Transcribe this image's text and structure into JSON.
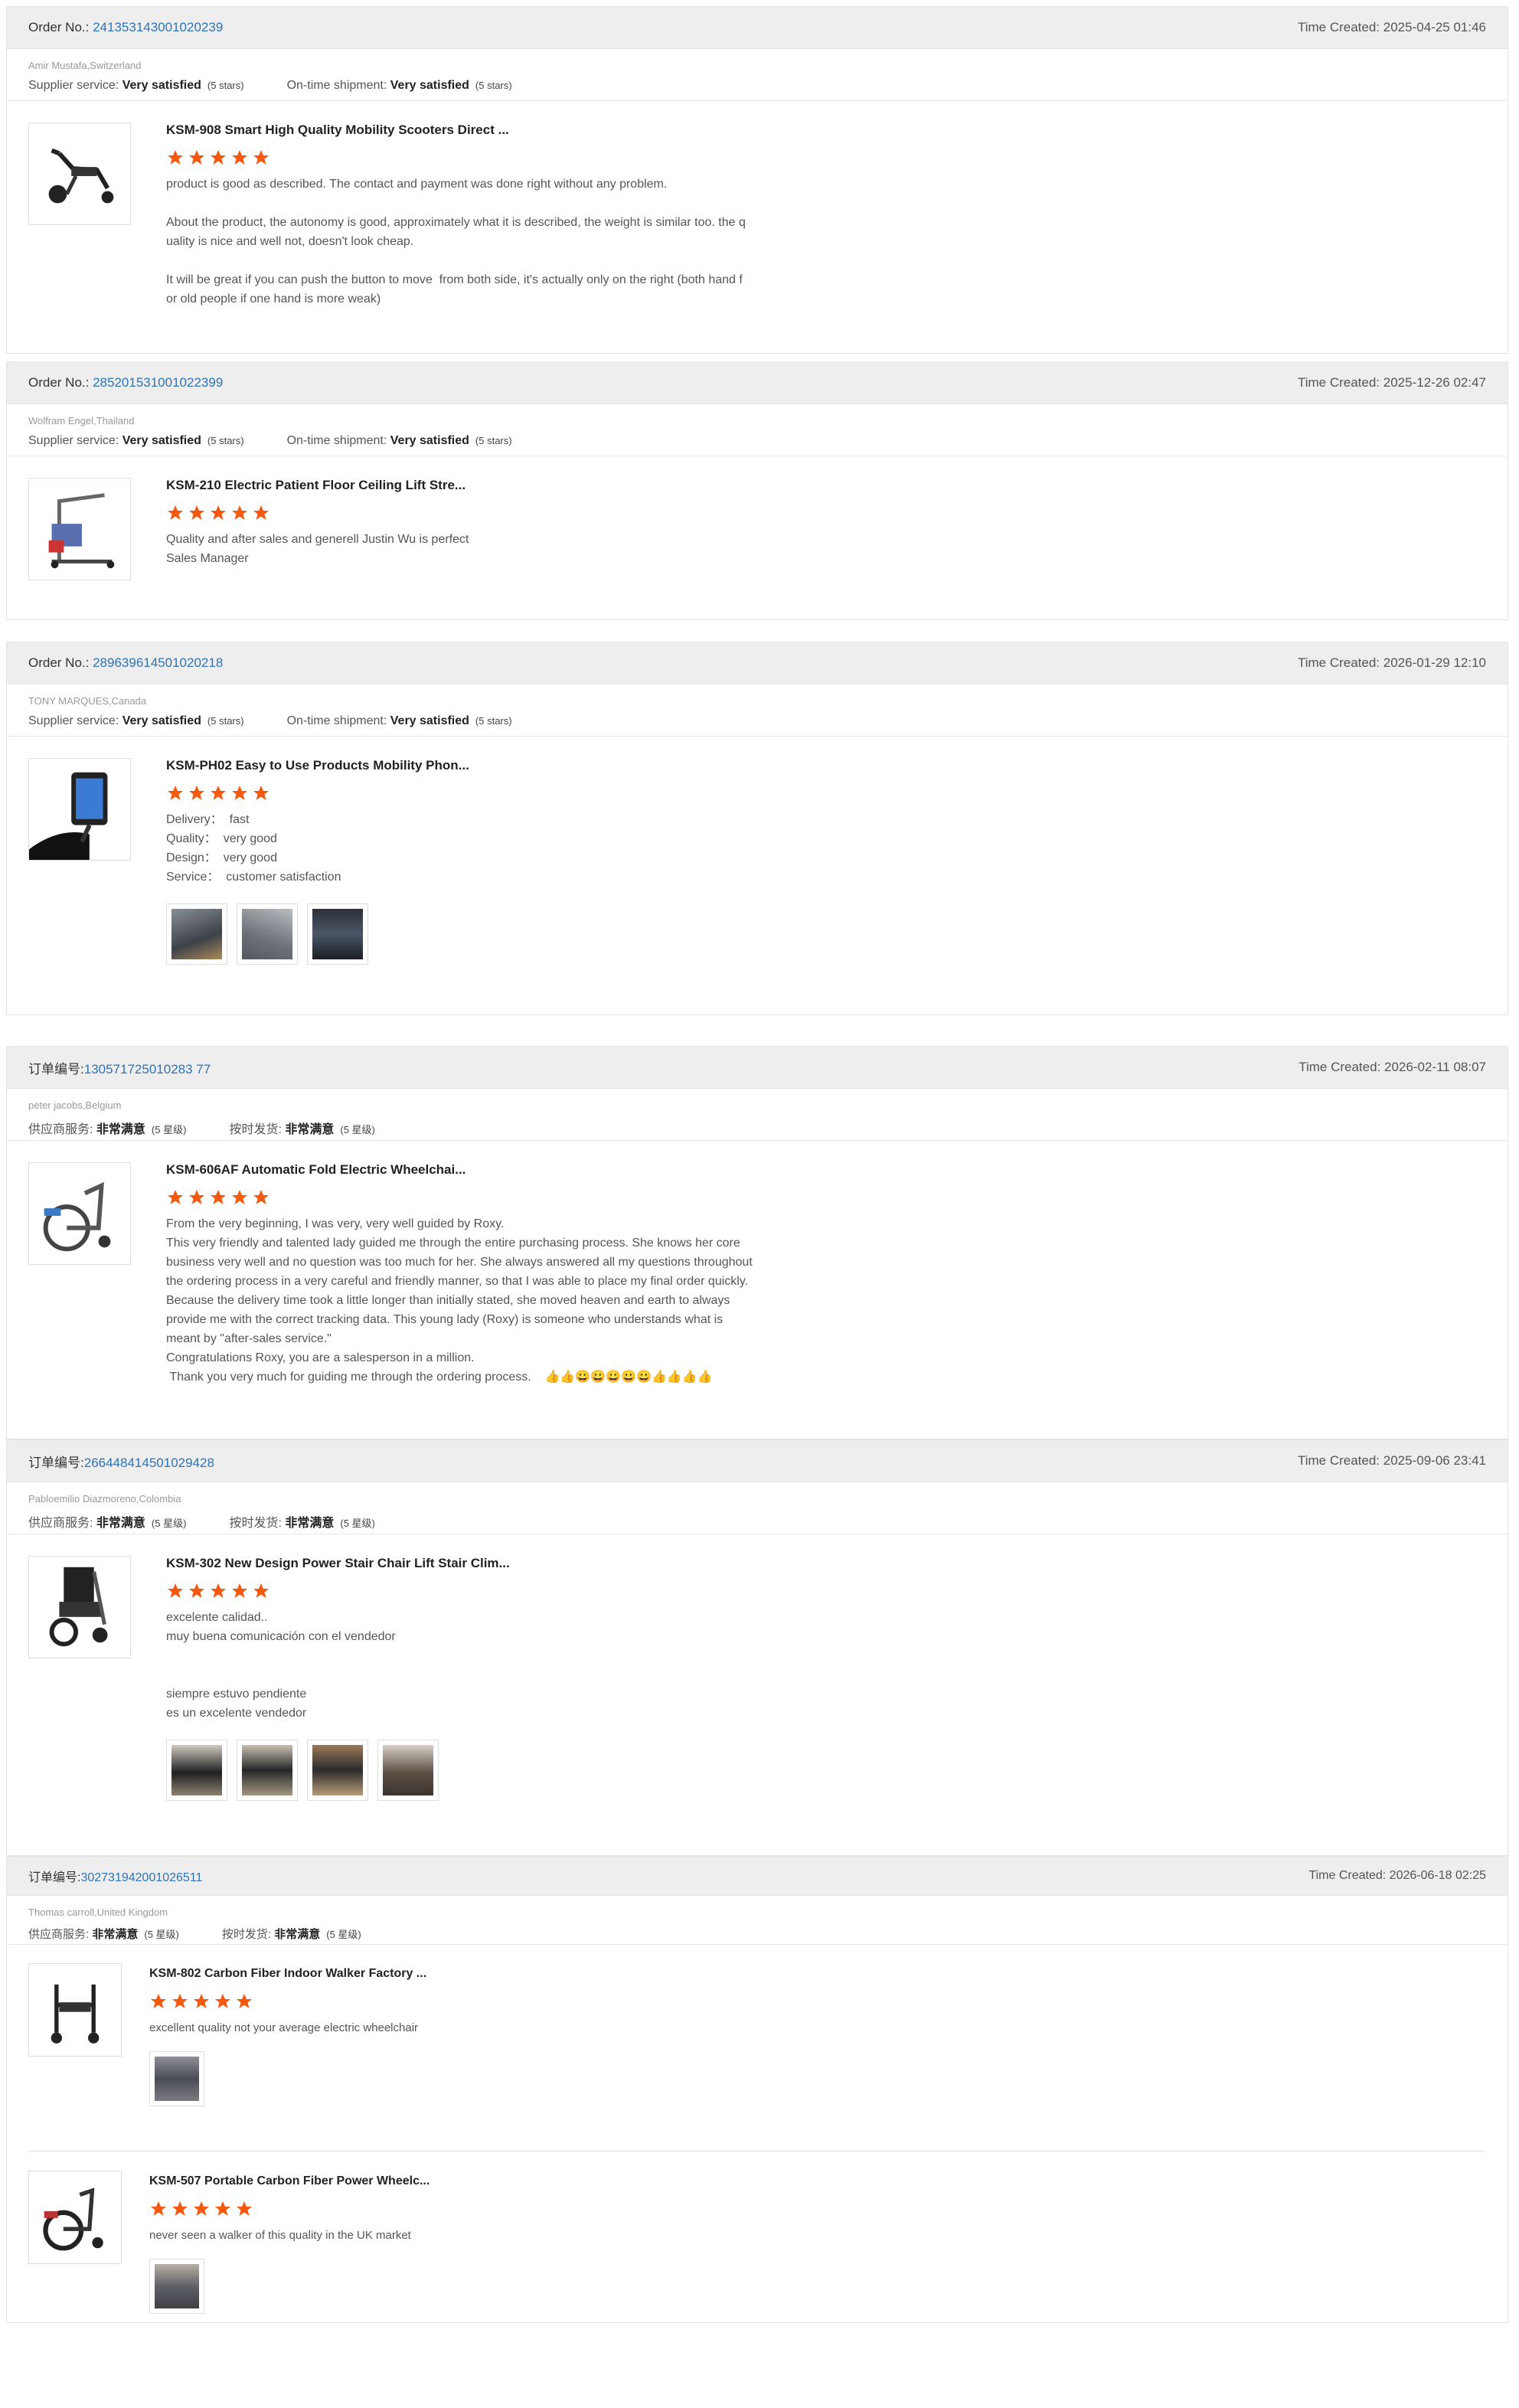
{
  "reviews": [
    {
      "order_label": "Order No.:",
      "order_no": "241353143001020239",
      "time_label": "Time Created:",
      "time": "2025-04-25 01:46",
      "buyer": "Amir Mustafa,Switzerland",
      "supplier_label": "Supplier service:",
      "supplier_value": "Very satisfied",
      "supplier_stars": "(5 stars)",
      "shipment_label": "On-time shipment:",
      "shipment_value": "Very satisfied",
      "shipment_stars": "(5 stars)",
      "items": [
        {
          "product": "KSM-908 Smart High Quality Mobility Scooters Direct ...",
          "rating": 5,
          "text": "product is good as described. The contact and payment was done right without any problem.\n\nAbout the product, the autonomy is good, approximately what it is described, the weight is similar too. the q\nuality is nice and well not, doesn't look cheap.\n\nIt will be great if you can push the button to move  from both side, it's actually only on the right (both hand f\nor old people if one hand is more weak)",
          "image": "scooter-image"
        }
      ]
    },
    {
      "order_label": "Order No.:",
      "order_no": "285201531001022399",
      "time_label": "Time Created:",
      "time": "2025-12-26 02:47",
      "buyer": "Wolfram Engel,Thailand",
      "supplier_label": "Supplier service:",
      "supplier_value": "Very satisfied",
      "supplier_stars": "(5 stars)",
      "shipment_label": "On-time shipment:",
      "shipment_value": "Very satisfied",
      "shipment_stars": "(5 stars)",
      "items": [
        {
          "product": "KSM-210 Electric Patient Floor Ceiling Lift Stre...",
          "rating": 5,
          "text": "Quality and after sales and generell Justin Wu is perfect\nSales Manager",
          "image": "patient-lift-image"
        }
      ]
    },
    {
      "order_label": "Order No.:",
      "order_no": "289639614501020218",
      "time_label": "Time Created:",
      "time": "2026-01-29 12:10",
      "buyer": "TONY MARQUES,Canada",
      "supplier_label": "Supplier service:",
      "supplier_value": "Very satisfied",
      "supplier_stars": "(5 stars)",
      "shipment_label": "On-time shipment:",
      "shipment_value": "Very satisfied",
      "shipment_stars": "(5 stars)",
      "items": [
        {
          "product": "KSM-PH02 Easy to Use Products Mobility Phon...",
          "rating": 5,
          "text": "Delivery：  fast\nQuality：  very good\nDesign：  very good\nService：  customer satisfaction",
          "image": "phone-holder-image",
          "photos": 3
        }
      ]
    },
    {
      "order_label": "订单编号:",
      "order_no": "130571725010283 77",
      "time_label": "Time Created:",
      "time": "2026-02-11 08:07",
      "buyer": "peter jacobs,Belgium",
      "supplier_label": "供应商服务:",
      "supplier_value": "非常满意",
      "supplier_stars": "(5 星级)",
      "shipment_label": "按时发货:",
      "shipment_value": "非常满意",
      "shipment_stars": "(5 星级)",
      "items": [
        {
          "product": "KSM-606AF Automatic Fold Electric Wheelchai...",
          "rating": 5,
          "text": "From the very beginning, I was very, very well guided by Roxy.\nThis very friendly and talented lady guided me through the entire purchasing process. She knows her core\nbusiness very well and no question was too much for her. She always answered all my questions throughout\nthe ordering process in a very careful and friendly manner, so that I was able to place my final order quickly.\nBecause the delivery time took a little longer than initially stated, she moved heaven and earth to always\nprovide me with the correct tracking data. This young lady (Roxy) is someone who understands what is\nmeant by \"after-sales service.\"\nCongratulations Roxy, you are a salesperson in a million.\n Thank you very much for guiding me through the ordering process.    👍👍😀😀😀😀😀👍👍👍👍",
          "image": "folding-wheelchair-image"
        }
      ]
    },
    {
      "order_label": "订单编号:",
      "order_no": "266448414501029428",
      "time_label": "Time Created:",
      "time": "2025-09-06 23:41",
      "buyer": "Pabloemilio Diazmoreno,Colombia",
      "supplier_label": "供应商服务:",
      "supplier_value": "非常满意",
      "supplier_stars": "(5 星级)",
      "shipment_label": "按时发货:",
      "shipment_value": "非常满意",
      "shipment_stars": "(5 星级)",
      "items": [
        {
          "product": "KSM-302 New Design Power Stair Chair Lift Stair Clim...",
          "rating": 5,
          "text": "excelente calidad..\nmuy buena comunicación con el vendedor\n\n\nsiempre estuvo pendiente\nes un excelente vendedor",
          "image": "stair-chair-image",
          "photos": 4
        }
      ]
    },
    {
      "order_label": "订单编号:",
      "order_no": "302731942001026511",
      "time_label": "Time Created:",
      "time": "2026-06-18 02:25",
      "buyer": "Thomas carroll,United Kingdom",
      "supplier_label": "供应商服务:",
      "supplier_value": "非常满意",
      "supplier_stars": "(5 星级)",
      "shipment_label": "按时发货:",
      "shipment_value": "非常满意",
      "shipment_stars": "(5 星级)",
      "items": [
        {
          "product": "KSM-802 Carbon Fiber Indoor Walker Factory ...",
          "rating": 5,
          "text": "excellent quality not your average electric wheelchair",
          "image": "walker-image",
          "photos": 1
        },
        {
          "product": "KSM-507 Portable Carbon Fiber Power Wheelc...",
          "rating": 5,
          "text": "never seen a walker of this quality in the UK market",
          "image": "power-wheelchair-image",
          "photos": 1
        }
      ]
    }
  ],
  "colors": {
    "link": "#2f73b6",
    "star": "#f35a10",
    "header_bg": "#eeeeee"
  }
}
